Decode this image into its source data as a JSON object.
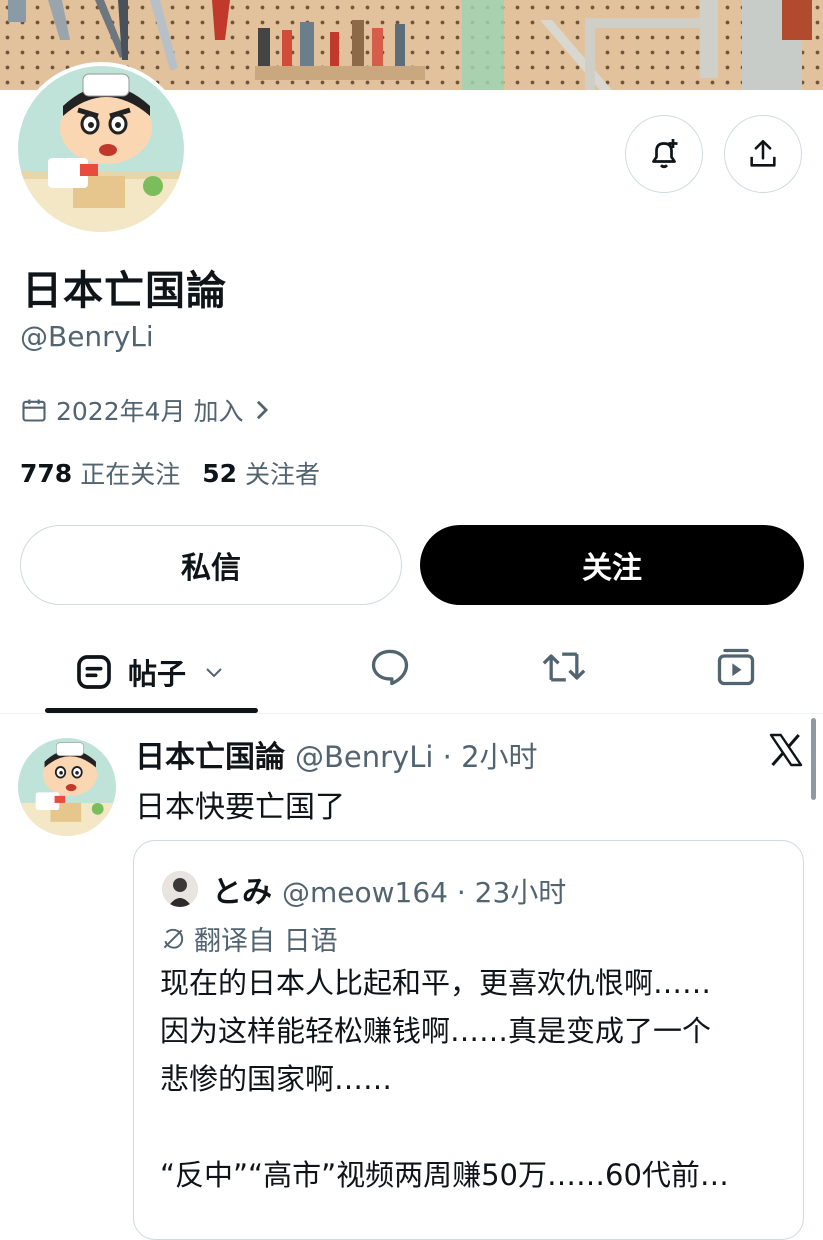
{
  "profile": {
    "display_name": "日本亡国論",
    "handle": "@BenryLi",
    "joined": "2022年4月 加入",
    "following_count": "778",
    "following_label": "正在关注",
    "followers_count": "52",
    "followers_label": "关注者"
  },
  "actions": {
    "message_label": "私信",
    "follow_label": "关注",
    "notify_icon": "bell-plus-icon",
    "share_icon": "share-upload-icon"
  },
  "tabs": {
    "posts_label": "帖子",
    "items": [
      "posts",
      "replies",
      "reposts",
      "videos"
    ]
  },
  "post": {
    "name": "日本亡国論",
    "handle_time": "@BenryLi · 2小时",
    "text": "日本快要亡国了",
    "quote": {
      "name": "とみ",
      "handle_time": "@meow164 · 23小时",
      "translated": "翻译自 日语",
      "lines": [
        "现在的日本人比起和平，更喜欢仇恨啊……",
        "因为这样能轻松赚钱啊……真是变成了一个",
        "悲惨的国家啊……",
        "",
        "“反中”“高市”视频两周赚50万……60代前…"
      ]
    }
  },
  "colors": {
    "text": "#0f1419",
    "secondary": "#536471",
    "border": "#cfd9de",
    "follow_bg": "#000000"
  }
}
